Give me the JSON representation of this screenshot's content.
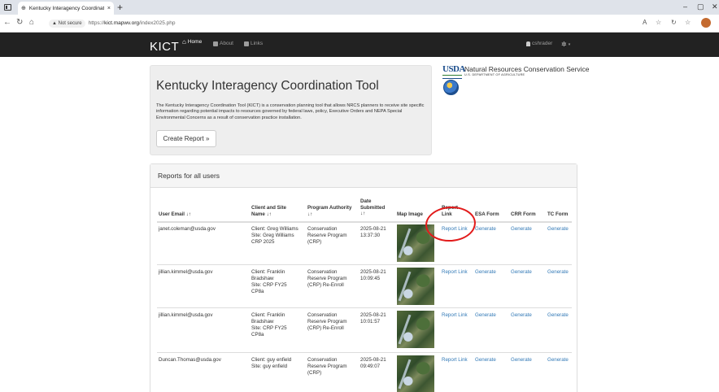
{
  "browser": {
    "tab_title": "Kentucky Interagency Coordinati",
    "tab_close": "×",
    "new_tab": "+",
    "not_secure": "▲ Not secure",
    "url_prefix": "https://",
    "url_host": "kict.mapwv.org",
    "url_path": "/index2025.php",
    "win_min": "–",
    "win_max": "▢",
    "win_close": "✕"
  },
  "navbar": {
    "brand": "KICT",
    "home": "Home",
    "about": "About",
    "links": "Links",
    "user": "cshrader"
  },
  "jumbotron": {
    "title": "Kentucky Interagency Coordination Tool",
    "description": "The Kentucky Interagency Coordination Tool (KICT) is a conservation planning tool that allows NRCS planners to receive site specific information regarding potential impacts to resources governed by federal laws, policy, Executive Orders and NEPA Special Environmental Concerns as a result of conservation practice installation.",
    "button": "Create Report »"
  },
  "usda": {
    "logo": "USDA",
    "agency": "Natural Resources Conservation Service",
    "department": "U.S. DEPARTMENT OF AGRICULTURE"
  },
  "reports": {
    "title": "Reports for all users",
    "headers": {
      "email": "User Email ↓↑",
      "client_line1": "Client and Site",
      "client_line2": "Name ↓↑",
      "program_line1": "Program Authority",
      "program_line2": "↓↑",
      "date_line1": "Date",
      "date_line2": "Submitted",
      "date_line3": "↓↑",
      "map": "Map Image",
      "report_line1": "Report",
      "report_line2": "Link",
      "esa": "ESA Form",
      "crr": "CRR Form",
      "tc": "TC Form"
    },
    "rows": [
      {
        "email": "janet.coleman@usda.gov",
        "client1": "Client: Greg Williams",
        "client2": "Site: Greg Williams",
        "client3": "CRP 2025",
        "client4": "",
        "program1": "Conservation",
        "program2": "Reserve Program",
        "program3": "(CRP)",
        "date1": "2025-08-21",
        "date2": "13:37:30",
        "report": "Report Link",
        "esa": "Generate",
        "crr": "Generate",
        "tc": "Generate"
      },
      {
        "email": "jillian.kimmel@usda.gov",
        "client1": "Client: Franklin",
        "client2": "Bradshaw",
        "client3": "Site: CRP FY25",
        "client4": "CP8a",
        "program1": "Conservation",
        "program2": "Reserve Program",
        "program3": "(CRP) Re-Enroll",
        "date1": "2025-08-21",
        "date2": "10:09:45",
        "report": "Report Link",
        "esa": "Generate",
        "crr": "Generate",
        "tc": "Generate"
      },
      {
        "email": "jillian.kimmel@usda.gov",
        "client1": "Client: Franklin",
        "client2": "Bradshaw",
        "client3": "Site: CRP FY25",
        "client4": "CP8a",
        "program1": "Conservation",
        "program2": "Reserve Program",
        "program3": "(CRP) Re-Enroll",
        "date1": "2025-08-21",
        "date2": "10:01:57",
        "report": "Report Link",
        "esa": "Generate",
        "crr": "Generate",
        "tc": "Generate"
      },
      {
        "email": "Duncan.Thomas@usda.gov",
        "client1": "Client: guy enfield",
        "client2": "Site: guy enfield",
        "client3": "",
        "client4": "",
        "program1": "Conservation",
        "program2": "Reserve Program",
        "program3": "(CRP)",
        "date1": "2025-08-21",
        "date2": "09:49:07",
        "report": "Report Link",
        "esa": "Generate",
        "crr": "Generate",
        "tc": "Generate"
      }
    ]
  },
  "colors": {
    "navbar_bg": "#222222",
    "link": "#337ab7",
    "annotation": "#e21b1b"
  }
}
